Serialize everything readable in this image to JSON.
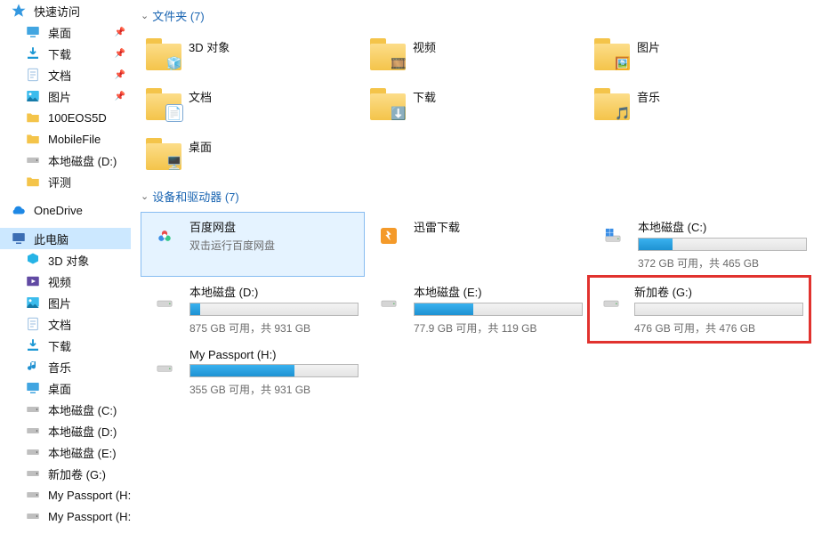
{
  "sidebar": {
    "quick_access": "快速访问",
    "children": [
      {
        "label": "桌面",
        "icon": "desktop",
        "pinned": true
      },
      {
        "label": "下载",
        "icon": "download",
        "pinned": true
      },
      {
        "label": "文档",
        "icon": "doc",
        "pinned": true
      },
      {
        "label": "图片",
        "icon": "picture",
        "pinned": true
      },
      {
        "label": "100EOS5D",
        "icon": "folder"
      },
      {
        "label": "MobileFile",
        "icon": "folder"
      },
      {
        "label": "本地磁盘 (D:)",
        "icon": "drive"
      },
      {
        "label": "评测",
        "icon": "folder"
      }
    ],
    "onedrive": "OneDrive",
    "this_pc": "此电脑",
    "pc_children": [
      {
        "label": "3D 对象",
        "icon": "obj3d"
      },
      {
        "label": "视频",
        "icon": "video"
      },
      {
        "label": "图片",
        "icon": "picture"
      },
      {
        "label": "文档",
        "icon": "doc"
      },
      {
        "label": "下载",
        "icon": "download"
      },
      {
        "label": "音乐",
        "icon": "music"
      },
      {
        "label": "桌面",
        "icon": "desktop"
      },
      {
        "label": "本地磁盘 (C:)",
        "icon": "drive"
      },
      {
        "label": "本地磁盘 (D:)",
        "icon": "drive"
      },
      {
        "label": "本地磁盘 (E:)",
        "icon": "drive"
      },
      {
        "label": "新加卷 (G:)",
        "icon": "drive"
      },
      {
        "label": "My Passport (H:)",
        "icon": "drive"
      },
      {
        "label": "My Passport (H:)",
        "icon": "drive"
      }
    ]
  },
  "sections": {
    "folders_header": "文件夹 (7)",
    "drives_header": "设备和驱动器 (7)"
  },
  "folders": [
    {
      "label": "3D 对象",
      "badge": "cube"
    },
    {
      "label": "视频",
      "badge": "film"
    },
    {
      "label": "图片",
      "badge": "photo"
    },
    {
      "label": "文档",
      "badge": "sheet"
    },
    {
      "label": "下载",
      "badge": "arrow"
    },
    {
      "label": "音乐",
      "badge": "note"
    },
    {
      "label": "桌面",
      "badge": "desk"
    }
  ],
  "drives": [
    {
      "name": "百度网盘",
      "sub": "双击运行百度网盘",
      "icon": "bdisk",
      "selected": true
    },
    {
      "name": "迅雷下载",
      "sub": "",
      "icon": "xunlei"
    },
    {
      "name": "本地磁盘 (C:)",
      "sub": "372 GB 可用，共 465 GB",
      "fill": 0.2,
      "osdrive": true
    },
    {
      "name": "本地磁盘 (D:)",
      "sub": "875 GB 可用，共 931 GB",
      "fill": 0.06
    },
    {
      "name": "本地磁盘 (E:)",
      "sub": "77.9 GB 可用，共 119 GB",
      "fill": 0.35
    },
    {
      "name": "新加卷 (G:)",
      "sub": "476 GB 可用，共 476 GB",
      "fill": 0.0,
      "highlight": true
    },
    {
      "name": "My Passport (H:)",
      "sub": "355 GB 可用，共 931 GB",
      "fill": 0.62
    }
  ]
}
